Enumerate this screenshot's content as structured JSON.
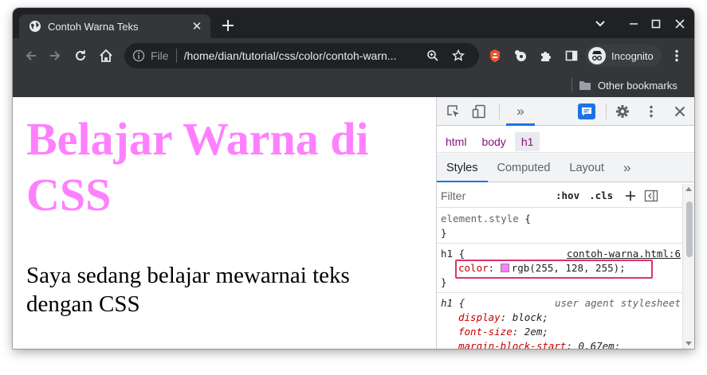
{
  "browser": {
    "tab": {
      "title": "Contoh Warna Teks",
      "close_glyph": "✕"
    },
    "omnibox": {
      "scheme": "File",
      "url": "/home/dian/tutorial/css/color/contoh-warn..."
    },
    "incognito_label": "Incognito",
    "bookmarks": {
      "other": "Other bookmarks"
    }
  },
  "page": {
    "heading": "Belajar Warna di CSS",
    "paragraph": "Saya sedang belajar mewarnai teks dengan CSS",
    "heading_color": "#ff80ff"
  },
  "devtools": {
    "breadcrumbs": [
      "html",
      "body",
      "h1"
    ],
    "tabs": [
      "Styles",
      "Computed",
      "Layout"
    ],
    "tabs_more": "»",
    "panel_more": "»",
    "filter_placeholder": "Filter",
    "hov": ":hov",
    "cls": ".cls",
    "rules": {
      "element_style": {
        "selector": "element.style",
        "open": " {",
        "close": "}"
      },
      "h1_author": {
        "selector": "h1",
        "open": " {",
        "source": "contoh-warna.html:6",
        "prop": "color",
        "colon": ": ",
        "value": "rgb(255, 128, 255)",
        "semi": ";",
        "close": "}",
        "swatch_color": "#ff80ff"
      },
      "h1_ua": {
        "selector": "h1",
        "open": " {",
        "source": "user agent stylesheet",
        "decls": [
          {
            "prop": "display",
            "value": "block"
          },
          {
            "prop": "font-size",
            "value": "2em"
          },
          {
            "prop": "margin-block-start",
            "value": "0.67em"
          }
        ]
      }
    },
    "accent_color": "#1a73e8",
    "highlight_color": "#e0306e"
  }
}
